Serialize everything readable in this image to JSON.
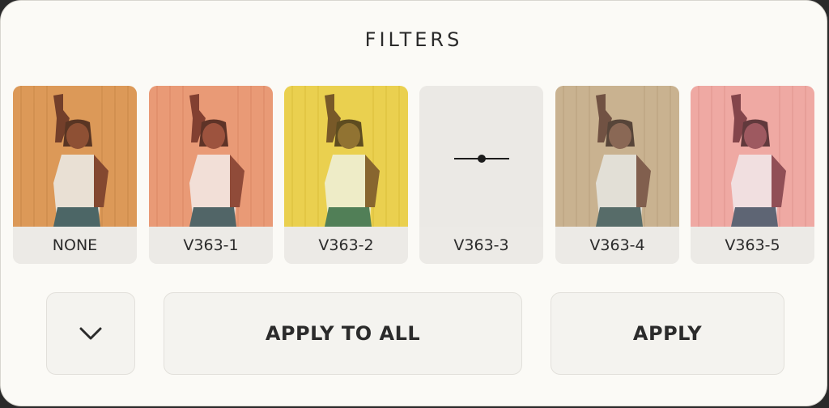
{
  "header": {
    "title": "FILTERS"
  },
  "filters": [
    {
      "label": "NONE",
      "tint": "#e9a25a",
      "tint_opacity": 0.45,
      "selected": false
    },
    {
      "label": "V363-1",
      "tint": "#f49a70",
      "tint_opacity": 0.45,
      "selected": false
    },
    {
      "label": "V363-2",
      "tint": "#f2d64a",
      "tint_opacity": 0.55,
      "selected": false
    },
    {
      "label": "V363-3",
      "tint": "#ebe9e5",
      "tint_opacity": 0.0,
      "selected": true
    },
    {
      "label": "V363-4",
      "tint": "#cbb48f",
      "tint_opacity": 0.55,
      "selected": false
    },
    {
      "label": "V363-5",
      "tint": "#f2a6a0",
      "tint_opacity": 0.55,
      "selected": false
    }
  ],
  "actions": {
    "more_icon": "chevron-down-icon",
    "apply_all_label": "APPLY TO ALL",
    "apply_label": "APPLY"
  }
}
